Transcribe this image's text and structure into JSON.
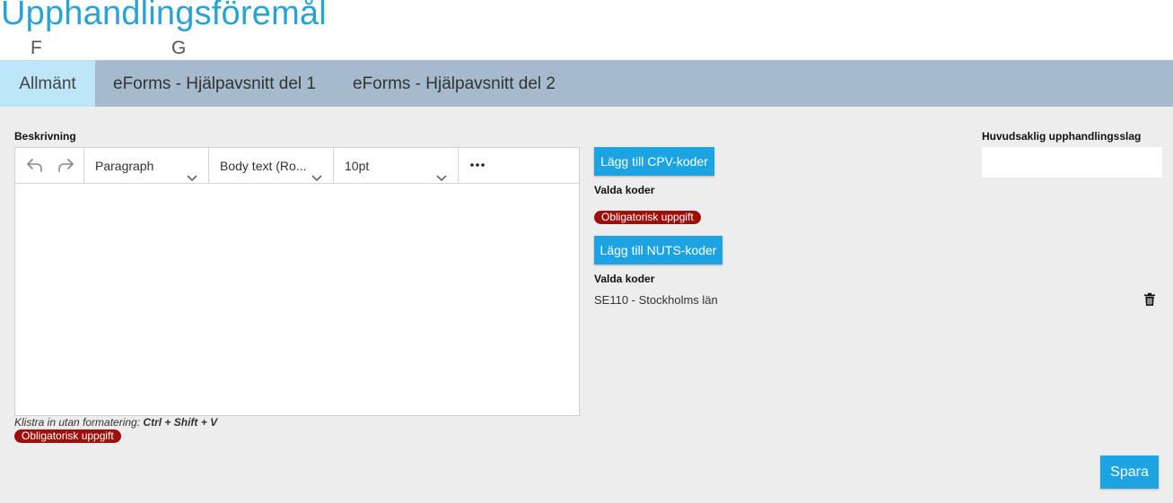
{
  "header": {
    "title": "Upphandlingsföremål",
    "key_hints": [
      "F",
      "G"
    ]
  },
  "tabs": [
    {
      "label": "Allmänt",
      "active": true
    },
    {
      "label": "eForms - Hjälpavsnitt del 1",
      "active": false
    },
    {
      "label": "eForms - Hjälpavsnitt del 2",
      "active": false
    }
  ],
  "description": {
    "label": "Beskrivning",
    "toolbar": {
      "undo_icon": "undo-icon",
      "redo_icon": "redo-icon",
      "block_format": "Paragraph",
      "font_family": "Body text (Ro...",
      "font_size": "10pt",
      "more_icon": "more-icon"
    },
    "content": "",
    "paste_hint_prefix": "Klistra in utan formatering: ",
    "paste_hint_shortcut": "Ctrl + Shift + V",
    "required_badge": "Obligatorisk uppgift"
  },
  "cpv": {
    "button_label": "Lägg till CPV-koder",
    "selected_label": "Valda koder",
    "required_badge": "Obligatorisk uppgift"
  },
  "nuts": {
    "button_label": "Lägg till NUTS-koder",
    "selected_label": "Valda koder",
    "codes": [
      "SE110 - Stockholms län"
    ]
  },
  "procurement_type": {
    "label": "Huvudsaklig upphandlingsslag",
    "value": ""
  },
  "save_button": "Spara",
  "colors": {
    "accent": "#1ba3e2",
    "title": "#29a3d4",
    "tabbar": "#a5bacd",
    "active_tab": "#bde6f8",
    "required_badge": "#9c0f0a"
  }
}
